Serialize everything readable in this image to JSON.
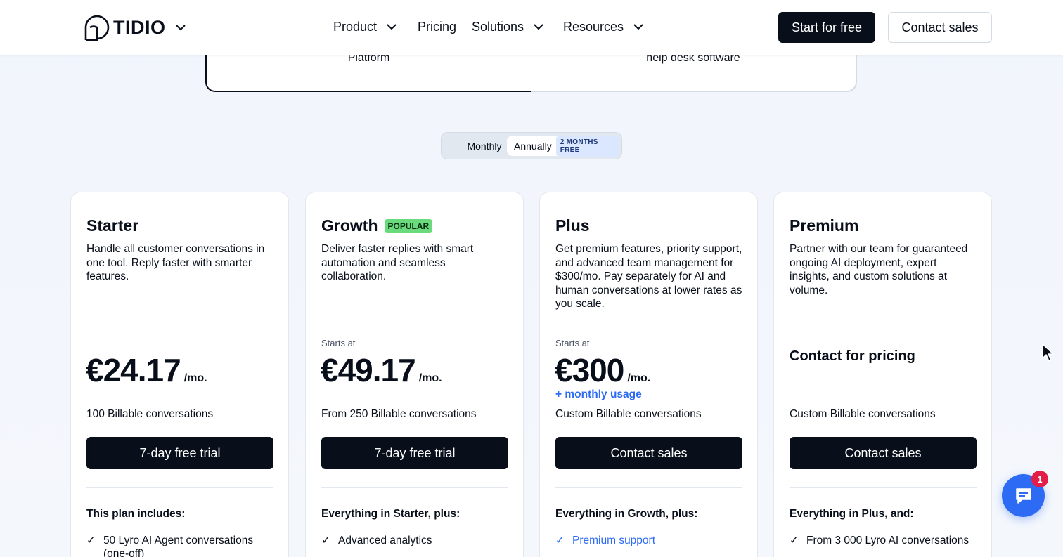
{
  "header": {
    "logo_text": "TIDIO",
    "nav": [
      {
        "label": "Product",
        "has_menu": true
      },
      {
        "label": "Pricing",
        "has_menu": false
      },
      {
        "label": "Solutions",
        "has_menu": true
      },
      {
        "label": "Resources",
        "has_menu": true
      }
    ],
    "start_free_label": "Start for free",
    "contact_sales_label": "Contact sales"
  },
  "product_tabs": [
    {
      "label": "Platform",
      "selected": true
    },
    {
      "label": "help desk software",
      "selected": false
    }
  ],
  "billing_toggle": {
    "monthly_label": "Monthly",
    "annual_label": "Annually",
    "annual_badge": "2 MONTHS FREE",
    "selected": "Annually"
  },
  "plans": [
    {
      "name": "Starter",
      "badge": "",
      "description": "Handle all customer conversations in one tool. Reply faster with smarter features.",
      "starts_at": "",
      "price": "€24.17",
      "per": "/mo.",
      "usage_note": "",
      "billable": "100 Billable conversations",
      "cta": "7-day free trial",
      "includes_heading": "This plan includes:",
      "first_feature": "50 Lyro AI Agent conversations (one-off)",
      "first_feature_highlight": false
    },
    {
      "name": "Growth",
      "badge": "POPULAR",
      "description": "Deliver faster replies with smart automation and seamless collaboration.",
      "starts_at": "Starts at",
      "price": "€49.17",
      "per": "/mo.",
      "usage_note": "",
      "billable": "From 250 Billable conversations",
      "cta": "7-day free trial",
      "includes_heading": "Everything in Starter, plus:",
      "first_feature": "Advanced analytics",
      "first_feature_highlight": false
    },
    {
      "name": "Plus",
      "badge": "",
      "description": "Get premium features, priority support, and advanced team management for $300/mo. Pay separately for AI and human conversations at lower rates as you scale.",
      "starts_at": "Starts at",
      "price": "€300",
      "per": "/mo.",
      "usage_note": "+ monthly usage",
      "billable": "Custom Billable conversations",
      "cta": "Contact sales",
      "includes_heading": "Everything in Growth, plus:",
      "first_feature": "Premium support",
      "first_feature_highlight": true
    },
    {
      "name": "Premium",
      "badge": "",
      "description": "Partner with our team for guaranteed ongoing AI deployment, expert insights, and custom solutions at volume.",
      "starts_at": "",
      "price": "",
      "contact_pricing": "Contact for pricing",
      "per": "",
      "usage_note": "",
      "billable": "Custom Billable conversations",
      "cta": "Contact sales",
      "includes_heading": "Everything in Plus, and:",
      "first_feature": "From 3 000 Lyro AI conversations",
      "first_feature_highlight": false
    }
  ],
  "chat_widget": {
    "unread_count": "1",
    "icon": "chat-bubble-icon"
  },
  "colors": {
    "dark": "#080f1a",
    "accent_blue": "#2d6bf5",
    "popular_green": "#69db7c"
  }
}
